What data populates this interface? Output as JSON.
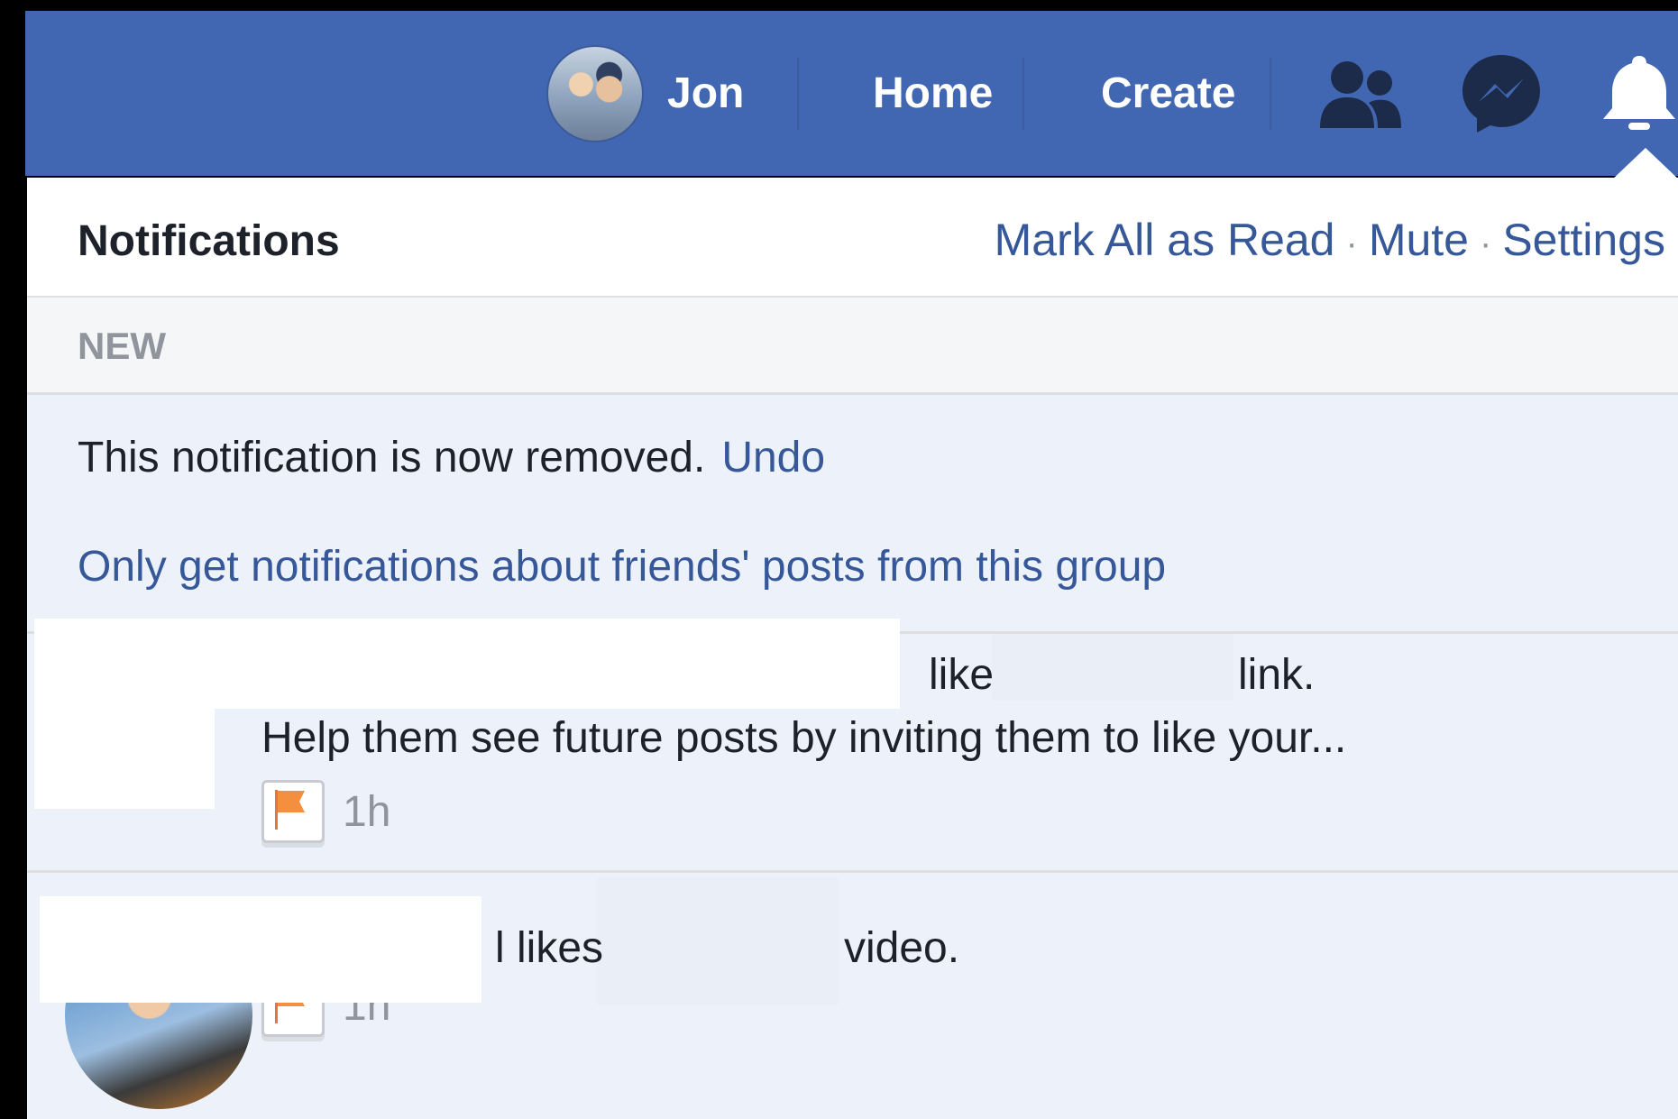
{
  "nav": {
    "profile_name": "Jon",
    "home_label": "Home",
    "create_label": "Create",
    "bg_color": "#4267b2"
  },
  "notifications": {
    "title": "Notifications",
    "mark_all_read": "Mark All as Read",
    "mute": "Mute",
    "settings": "Settings",
    "separator": "·",
    "section_label": "NEW",
    "removed_text": "This notification is now removed.",
    "undo_label": "Undo",
    "only_friends_link": "Only get notifications about friends' posts from this group",
    "items": [
      {
        "fragment_1": "like",
        "fragment_2": "link.",
        "preview": "Help them see future posts by inviting them to like your...",
        "time": "1h"
      },
      {
        "fragment_1": "l likes",
        "fragment_2": "video.",
        "time": "1h"
      }
    ]
  },
  "colors": {
    "link": "#365899",
    "unread_bg": "#edf2fa",
    "section_bg": "#f5f6f7"
  }
}
